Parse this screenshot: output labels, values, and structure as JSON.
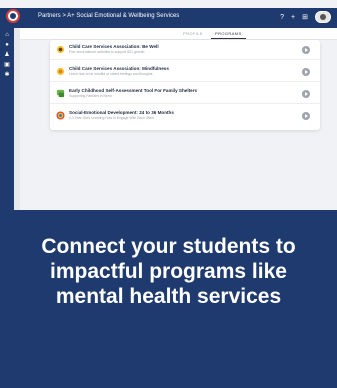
{
  "header": {
    "breadcrumb": "Partners > A+ Social Emotional & Wellbeing Services"
  },
  "tabs": [
    {
      "label": "PROFILE",
      "active": false
    },
    {
      "label": "PROGRAMS",
      "active": true
    }
  ],
  "programs": [
    {
      "title": "Child Care Services Association: Be Well",
      "subtitle": "Five short-takeout activities to support SEL growth",
      "icon": "sunflower-icon"
    },
    {
      "title": "Child Care Services Association: Mindfulness",
      "subtitle": "Learn how to be mindful of others feelings and thoughts",
      "icon": "sunflower-icon"
    },
    {
      "title": "Early Childhood Self-Assessment Tool For Family Shelters",
      "subtitle": "Supporting Families in Need",
      "icon": "chat-icon"
    },
    {
      "title": "Social-Emotional Development: 24 to 36 Months",
      "subtitle": "2-3 Year Old's Learning How to Engage With Each Other",
      "icon": "circle-logo-icon"
    }
  ],
  "promo": {
    "headline": "Connect your students to impactful programs like mental health services"
  },
  "colors": {
    "brand": "#1f3a6e",
    "accent": "#d23c3c"
  }
}
